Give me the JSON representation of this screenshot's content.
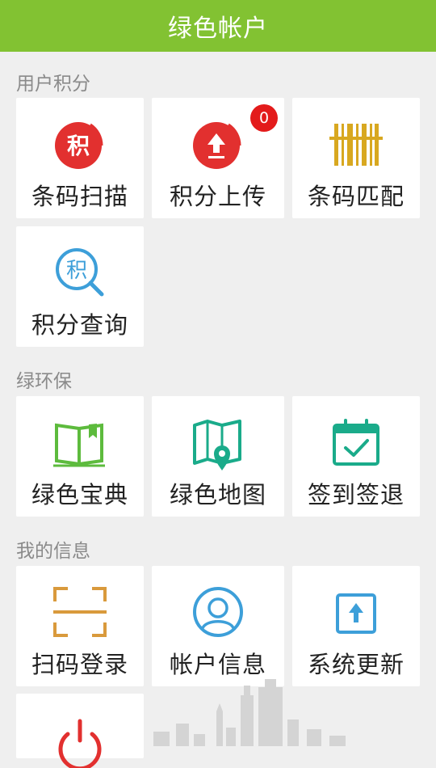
{
  "header": {
    "title": "绿色帐户"
  },
  "sections": {
    "points": {
      "title": "用户积分",
      "items": [
        {
          "label": "条码扫描",
          "icon": "points-circle-icon",
          "badge": ""
        },
        {
          "label": "积分上传",
          "icon": "upload-circle-icon",
          "badge": "0"
        },
        {
          "label": "条码匹配",
          "icon": "barcode-icon",
          "badge": ""
        },
        {
          "label": "积分查询",
          "icon": "points-search-icon",
          "badge": ""
        }
      ]
    },
    "eco": {
      "title": "绿环保",
      "items": [
        {
          "label": "绿色宝典",
          "icon": "book-icon"
        },
        {
          "label": "绿色地图",
          "icon": "map-pin-icon"
        },
        {
          "label": "签到签退",
          "icon": "calendar-check-icon"
        }
      ]
    },
    "myinfo": {
      "title": "我的信息",
      "items": [
        {
          "label": "扫码登录",
          "icon": "scan-frame-icon"
        },
        {
          "label": "帐户信息",
          "icon": "user-circle-icon"
        },
        {
          "label": "系统更新",
          "icon": "update-arrow-icon"
        },
        {
          "label": "",
          "icon": "power-icon"
        }
      ]
    }
  },
  "icon_glyphs": {
    "points": "积"
  },
  "colors": {
    "header": "#82c232",
    "red": "#e2302f",
    "gold": "#d8a820",
    "blue": "#3d9fd9",
    "green": "#5dbb3d",
    "teal": "#1aab8a",
    "orange": "#d99a3c"
  }
}
